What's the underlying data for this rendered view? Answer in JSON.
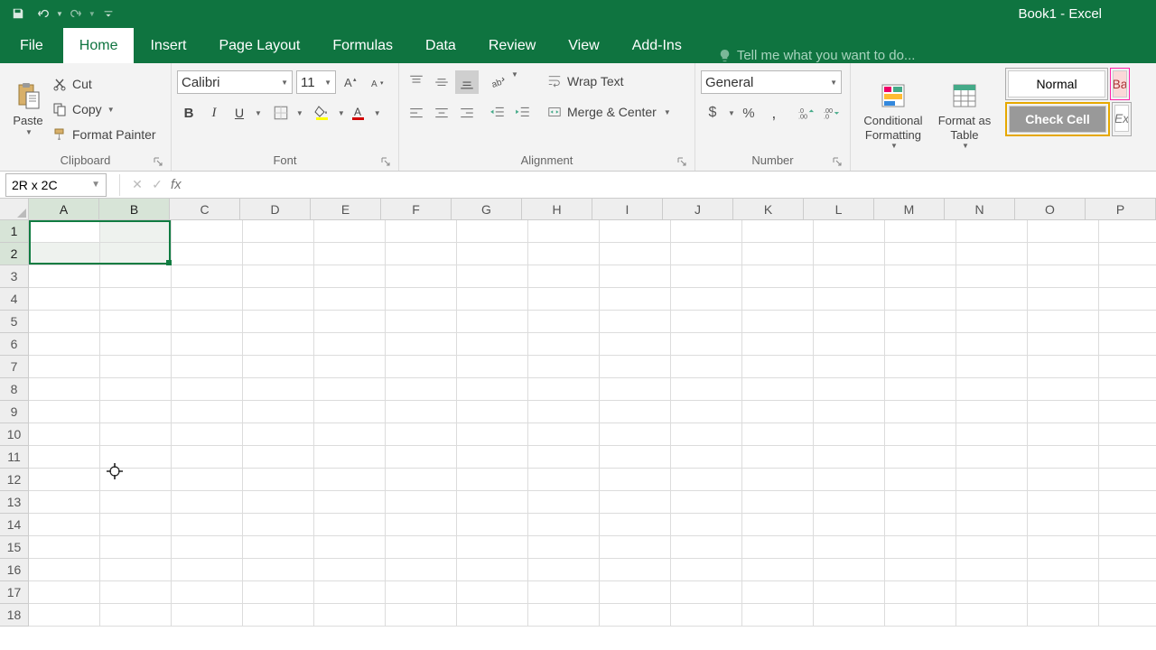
{
  "title": "Book1 - Excel",
  "tabs": {
    "file": "File",
    "home": "Home",
    "insert": "Insert",
    "page_layout": "Page Layout",
    "formulas": "Formulas",
    "data": "Data",
    "review": "Review",
    "view": "View",
    "addins": "Add-Ins"
  },
  "tellme_placeholder": "Tell me what you want to do...",
  "clipboard": {
    "paste": "Paste",
    "cut": "Cut",
    "copy": "Copy",
    "format_painter": "Format Painter",
    "label": "Clipboard"
  },
  "font": {
    "name": "Calibri",
    "size": "11",
    "label": "Font"
  },
  "alignment": {
    "wrap": "Wrap Text",
    "merge": "Merge & Center",
    "label": "Alignment"
  },
  "number": {
    "format": "General",
    "label": "Number"
  },
  "styles": {
    "cond": "Conditional\nFormatting",
    "table": "Format as\nTable",
    "normal": "Normal",
    "check": "Check Cell",
    "bad": "Ba",
    "exp": "Ex"
  },
  "name_box": "2R x 2C",
  "formula_value": "",
  "columns": [
    "A",
    "B",
    "C",
    "D",
    "E",
    "F",
    "G",
    "H",
    "I",
    "J",
    "K",
    "L",
    "M",
    "N",
    "O",
    "P"
  ],
  "rows": [
    "1",
    "2",
    "3",
    "4",
    "5",
    "6",
    "7",
    "8",
    "9",
    "10",
    "11",
    "12",
    "13",
    "14",
    "15",
    "16",
    "17",
    "18"
  ],
  "selection": {
    "rows": 2,
    "cols": 2,
    "active": "A1"
  }
}
